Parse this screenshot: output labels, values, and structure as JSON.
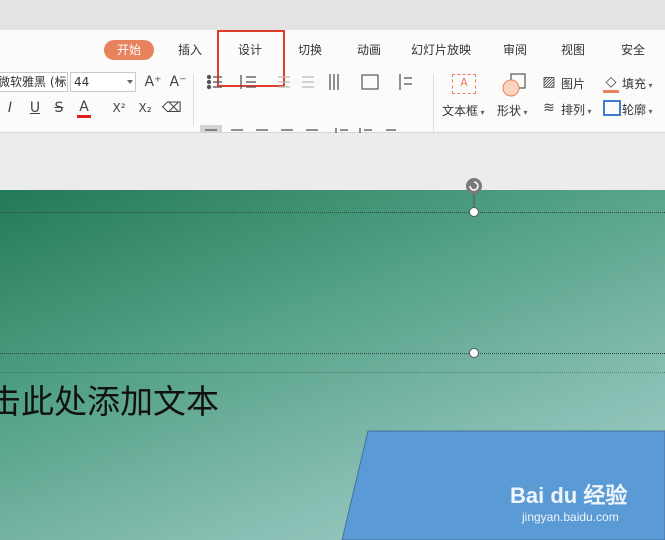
{
  "tabs": [
    {
      "label": "开始",
      "active": true
    },
    {
      "label": "插入",
      "active": false
    },
    {
      "label": "设计",
      "active": false,
      "highlighted": true
    },
    {
      "label": "切换",
      "active": false
    },
    {
      "label": "动画",
      "active": false
    },
    {
      "label": "幻灯片放映",
      "active": false
    },
    {
      "label": "审阅",
      "active": false
    },
    {
      "label": "视图",
      "active": false
    },
    {
      "label": "安全",
      "active": false
    }
  ],
  "font": {
    "family_value": "微软雅黑 (标题",
    "size_value": "44"
  },
  "buttons": {
    "textbox": "文本框",
    "shape": "形状",
    "picture": "图片",
    "arrange": "排列",
    "fill": "填充",
    "outline": "轮廓"
  },
  "icons": {
    "grow_font": "A⁺",
    "shrink_font": "A⁻",
    "italic": "I",
    "underline": "U",
    "strike": "S",
    "font_color": "A",
    "superscript": "X²",
    "subscript": "X₂",
    "clear": "⌫"
  },
  "slide": {
    "placeholder_text": "击此处添加文本"
  },
  "watermark": {
    "main": "Bai du 经验",
    "sub": "jingyan.baidu.com"
  },
  "colors": {
    "accent": "#e7825c",
    "highlight_box": "#e23b2e",
    "shape_blue": "#5b9bd5"
  }
}
